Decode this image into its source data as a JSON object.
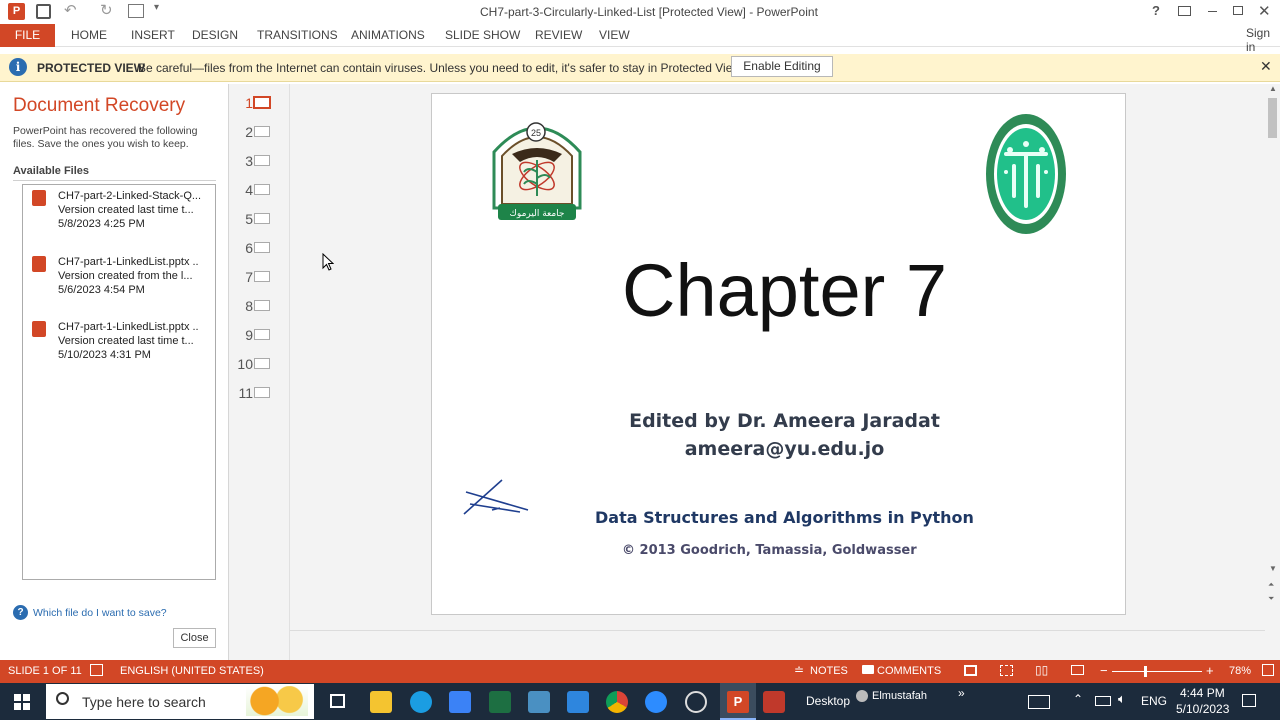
{
  "window": {
    "title": "CH7-part-3-Circularly-Linked-List [Protected View] - PowerPoint",
    "help": "?",
    "sign_in": "Sign in"
  },
  "ribbon": {
    "tabs": [
      "FILE",
      "HOME",
      "INSERT",
      "DESIGN",
      "TRANSITIONS",
      "ANIMATIONS",
      "SLIDE SHOW",
      "REVIEW",
      "VIEW"
    ]
  },
  "protected_view": {
    "label": "PROTECTED VIEW",
    "message": "Be careful—files from the Internet can contain viruses. Unless you need to edit, it's safer to stay in Protected View.",
    "enable_button": "Enable Editing"
  },
  "recovery": {
    "title": "Document Recovery",
    "description": "PowerPoint has recovered the following files.  Save the ones you wish to keep.",
    "available_files_label": "Available Files",
    "files": [
      {
        "name": "CH7-part-2-Linked-Stack-Q...",
        "status": "Version created last time t...",
        "time": "5/8/2023 4:25 PM"
      },
      {
        "name": "CH7-part-1-LinkedList.pptx ..",
        "status": "Version created from the l...",
        "time": "5/6/2023 4:54 PM"
      },
      {
        "name": "CH7-part-1-LinkedList.pptx ..",
        "status": "Version created last time t...",
        "time": "5/10/2023 4:31 PM"
      }
    ],
    "help_link": "Which file do I want to save?",
    "close_button": "Close"
  },
  "thumbnails": [
    "1",
    "2",
    "3",
    "4",
    "5",
    "6",
    "7",
    "8",
    "9",
    "10",
    "11"
  ],
  "slide": {
    "title": "Chapter 7",
    "author": "Edited by Dr. Ameera Jaradat",
    "email": "ameera@yu.edu.jo",
    "book": "Data Structures and Algorithms in Python",
    "copyright": "© 2013 Goodrich, Tamassia, Goldwasser",
    "logo_left_text": "جامعة اليرموك",
    "logo_left_year": "25"
  },
  "status": {
    "slide_indicator": "SLIDE 1 OF 11",
    "language": "ENGLISH (UNITED STATES)",
    "notes": "NOTES",
    "comments": "COMMENTS",
    "zoom": "78%"
  },
  "taskbar": {
    "search_placeholder": "Type here to search",
    "desktop": "Desktop",
    "user": "Elmustafah",
    "language": "ENG",
    "time": "4:44 PM",
    "date": "5/10/2023"
  },
  "colors": {
    "accent": "#d24726",
    "protected_bar": "#fff4ce",
    "taskbar": "#1c2b3c",
    "slide_text_dark": "#1f3864"
  }
}
